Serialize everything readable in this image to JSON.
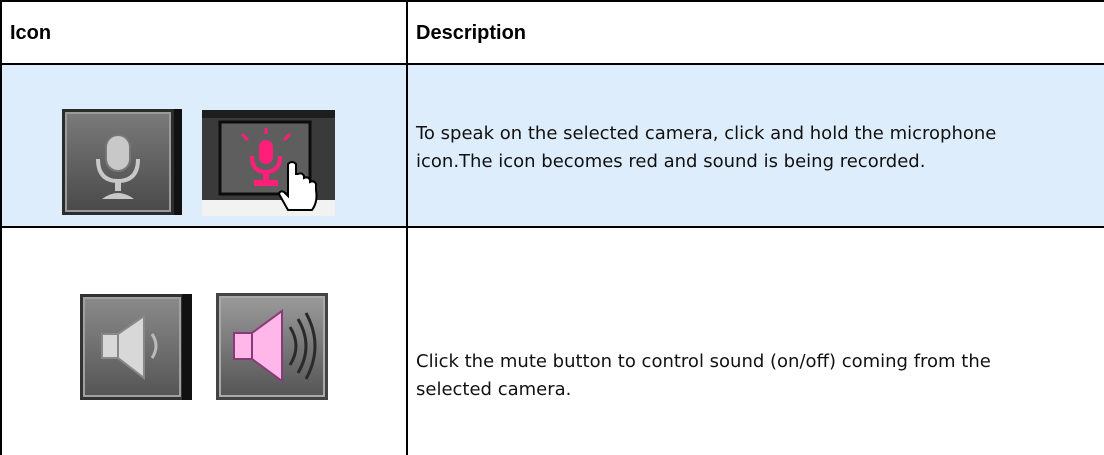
{
  "header": {
    "icon_col": "Icon",
    "description_col": "Description"
  },
  "rows": [
    {
      "icons": [
        "microphone-icon",
        "microphone-active-icon"
      ],
      "description_line1": "To speak on the selected camera, click and hold the microphone",
      "description_line2": "icon.The icon becomes red and sound is being recorded.",
      "active_color": "#ff1e78"
    },
    {
      "icons": [
        "speaker-muted-icon",
        "speaker-on-icon"
      ],
      "description_line1": "Click the mute button to control sound (on/off) coming from the",
      "description_line2": "selected camera.",
      "active_color": "#ffb6e8"
    }
  ],
  "colors": {
    "highlight_row": "#deedfb",
    "border": "#000000"
  }
}
